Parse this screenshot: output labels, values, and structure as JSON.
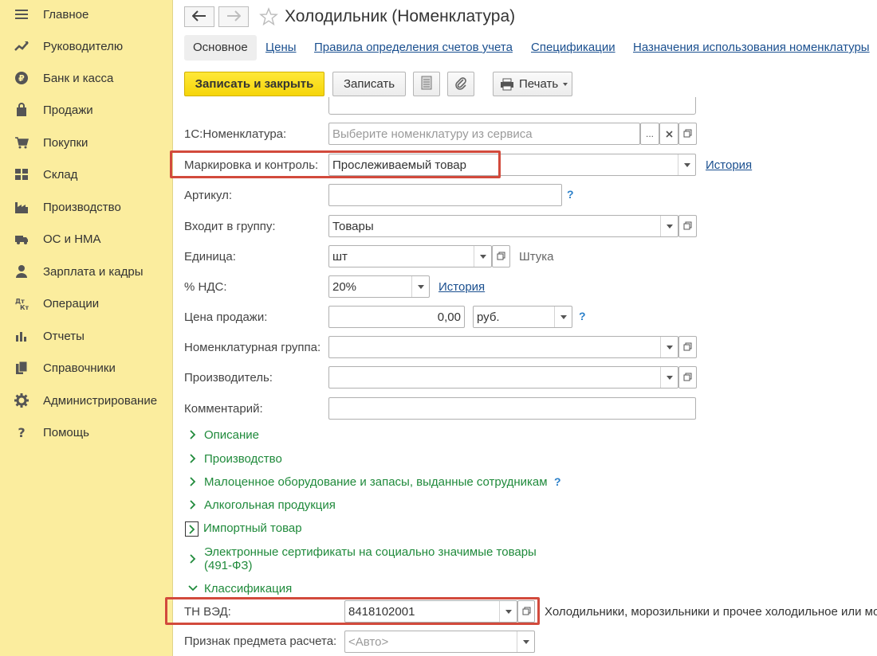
{
  "sidebar": {
    "items": [
      {
        "label": "Главное",
        "icon": "menu-icon"
      },
      {
        "label": "Руководителю",
        "icon": "trend-icon"
      },
      {
        "label": "Банк и касса",
        "icon": "coin-icon"
      },
      {
        "label": "Продажи",
        "icon": "bag-icon"
      },
      {
        "label": "Покупки",
        "icon": "cart-icon"
      },
      {
        "label": "Склад",
        "icon": "warehouse-icon"
      },
      {
        "label": "Производство",
        "icon": "factory-icon"
      },
      {
        "label": "ОС и НМА",
        "icon": "truck-icon"
      },
      {
        "label": "Зарплата и кадры",
        "icon": "person-icon"
      },
      {
        "label": "Операции",
        "icon": "operations-icon"
      },
      {
        "label": "Отчеты",
        "icon": "bar-chart-icon"
      },
      {
        "label": "Справочники",
        "icon": "books-icon"
      },
      {
        "label": "Администрирование",
        "icon": "gear-icon"
      },
      {
        "label": "Помощь",
        "icon": "question-icon"
      }
    ]
  },
  "header": {
    "title": "Холодильник (Номенклатура)"
  },
  "tabs": [
    {
      "label": "Основное"
    },
    {
      "label": "Цены"
    },
    {
      "label": "Правила определения счетов учета"
    },
    {
      "label": "Спецификации"
    },
    {
      "label": "Назначения использования номенклатуры"
    }
  ],
  "toolbar": {
    "save_close": "Записать и закрыть",
    "save": "Записать",
    "print": "Печать"
  },
  "form": {
    "nomenclature_1c": {
      "label": "1С:Номенклатура:",
      "placeholder": "Выберите номенклатуру из сервиса",
      "dots": "..."
    },
    "marking": {
      "label": "Маркировка и контроль:",
      "value": "Прослеживаемый товар",
      "history": "История"
    },
    "article": {
      "label": "Артикул:",
      "value": "",
      "help": "?"
    },
    "group": {
      "label": "Входит в группу:",
      "value": "Товары"
    },
    "unit": {
      "label": "Единица:",
      "value": "шт",
      "note": "Штука"
    },
    "vat": {
      "label": "% НДС:",
      "value": "20%",
      "history": "История"
    },
    "price": {
      "label": "Цена продажи:",
      "value": "0,00",
      "currency": "руб.",
      "help": "?"
    },
    "nom_group": {
      "label": "Номенклатурная группа:",
      "value": ""
    },
    "manufacturer": {
      "label": "Производитель:",
      "value": ""
    },
    "comment": {
      "label": "Комментарий:",
      "value": ""
    }
  },
  "sections": [
    {
      "label": "Описание",
      "expanded": false
    },
    {
      "label": "Производство",
      "expanded": false
    },
    {
      "label": "Малоценное оборудование и запасы, выданные сотрудникам",
      "expanded": false,
      "help": "?"
    },
    {
      "label": "Алкогольная продукция",
      "expanded": false
    },
    {
      "label": "Импортный товар",
      "expanded": false
    },
    {
      "label": "Электронные сертификаты на социально значимые товары",
      "label2": "(491-ФЗ)",
      "expanded": false
    },
    {
      "label": "Классификация",
      "expanded": true
    }
  ],
  "classification": {
    "tnved": {
      "label": "ТН ВЭД:",
      "value": "8418102001",
      "description": "Холодильники, морозильники и прочее холодильное или мо"
    },
    "payment_subject": {
      "label": "Признак предмета расчета:",
      "placeholder": "<Авто>"
    }
  },
  "colors": {
    "sidebar_bg": "#fbed9e",
    "primary_button": "#f5d50a",
    "link": "#1a4f8f",
    "section_green": "#1f8a3b",
    "highlight_red": "#d24a3c"
  }
}
